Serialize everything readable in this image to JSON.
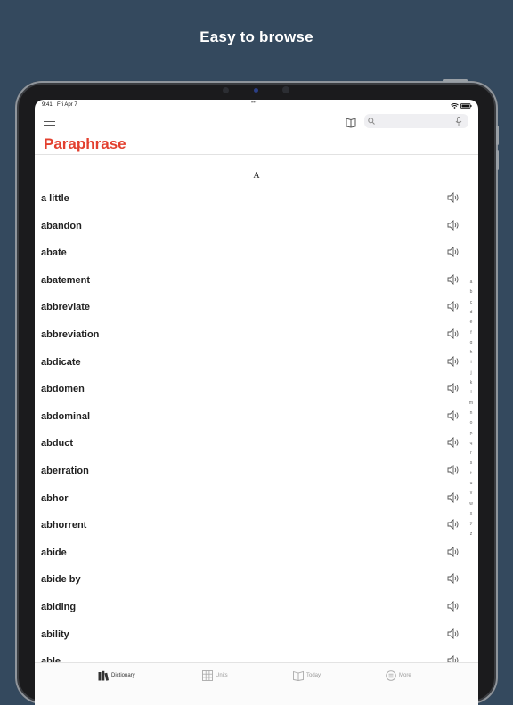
{
  "promo": {
    "headline": "Easy to browse"
  },
  "status_bar": {
    "time": "9:41",
    "date": "Fri Apr 7",
    "dots": "•••"
  },
  "toolbar": {
    "menu_icon": "hamburger-menu-icon",
    "book_icon": "open-book-icon",
    "search_placeholder": "",
    "search_value": "",
    "mic_icon": "microphone-icon"
  },
  "app": {
    "title": "Paraphrase",
    "title_color": "#e3402f"
  },
  "list": {
    "section_header": "A",
    "words": [
      "a little",
      "abandon",
      "abate",
      "abatement",
      "abbreviate",
      "abbreviation",
      "abdicate",
      "abdomen",
      "abdominal",
      "abduct",
      "aberration",
      "abhor",
      "abhorrent",
      "abide",
      "abide by",
      "abiding",
      "ability",
      "able"
    ],
    "speaker_icon": "speaker-icon"
  },
  "az_index": [
    "a",
    "b",
    "c",
    "d",
    "e",
    "f",
    "g",
    "h",
    "i",
    "j",
    "k",
    "l",
    "m",
    "n",
    "o",
    "p",
    "q",
    "r",
    "s",
    "t",
    "u",
    "v",
    "w",
    "x",
    "y",
    "z"
  ],
  "tabs": [
    {
      "label": "Dictionary",
      "icon": "books-icon",
      "active": true
    },
    {
      "label": "Units",
      "icon": "grid-icon",
      "active": false
    },
    {
      "label": "Today",
      "icon": "open-book-icon",
      "active": false
    },
    {
      "label": "More",
      "icon": "more-icon",
      "active": false
    }
  ]
}
